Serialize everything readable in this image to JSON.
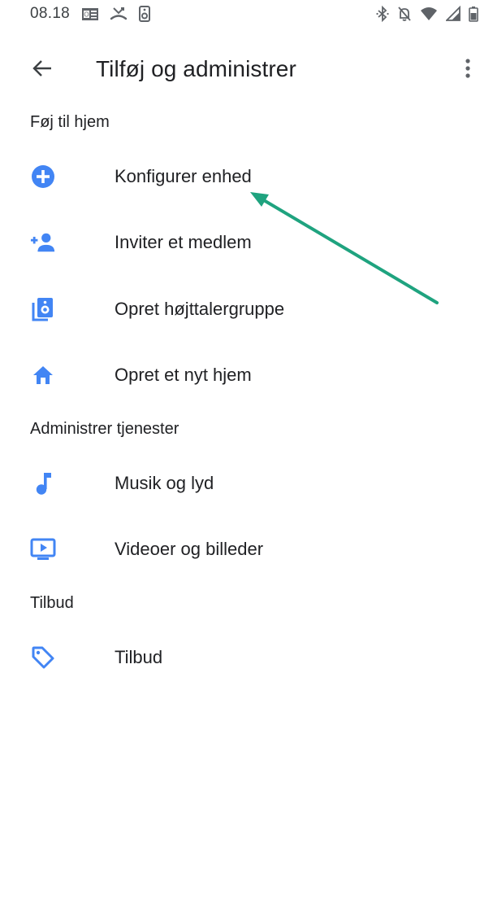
{
  "status_bar": {
    "time": "08.18",
    "left_icons": [
      "outlook-icon",
      "missed-call-icon",
      "speaker-icon"
    ],
    "right_icons": [
      "bluetooth-icon",
      "notifications-off-icon",
      "wifi-icon",
      "signal-icon",
      "battery-icon"
    ]
  },
  "app_bar": {
    "title": "Tilføj og administrer",
    "back_icon": "arrow-back-icon",
    "overflow_icon": "more-vert-icon"
  },
  "sections": [
    {
      "header": "Føj til hjem",
      "items": [
        {
          "label": "Konfigurer enhed",
          "icon": "add-circle-icon"
        },
        {
          "label": "Inviter et medlem",
          "icon": "person-add-icon"
        },
        {
          "label": "Opret højttalergruppe",
          "icon": "speaker-group-icon"
        },
        {
          "label": "Opret et nyt hjem",
          "icon": "home-icon"
        }
      ]
    },
    {
      "header": "Administrer tjenester",
      "items": [
        {
          "label": "Musik og lyd",
          "icon": "music-note-icon"
        },
        {
          "label": "Videoer og billeder",
          "icon": "video-library-icon"
        }
      ]
    },
    {
      "header": "Tilbud",
      "items": [
        {
          "label": "Tilbud",
          "icon": "offer-tag-icon"
        }
      ]
    }
  ],
  "colors": {
    "accent": "#4285f4",
    "annotation_arrow": "#1fa37f",
    "text_primary": "#202124"
  }
}
